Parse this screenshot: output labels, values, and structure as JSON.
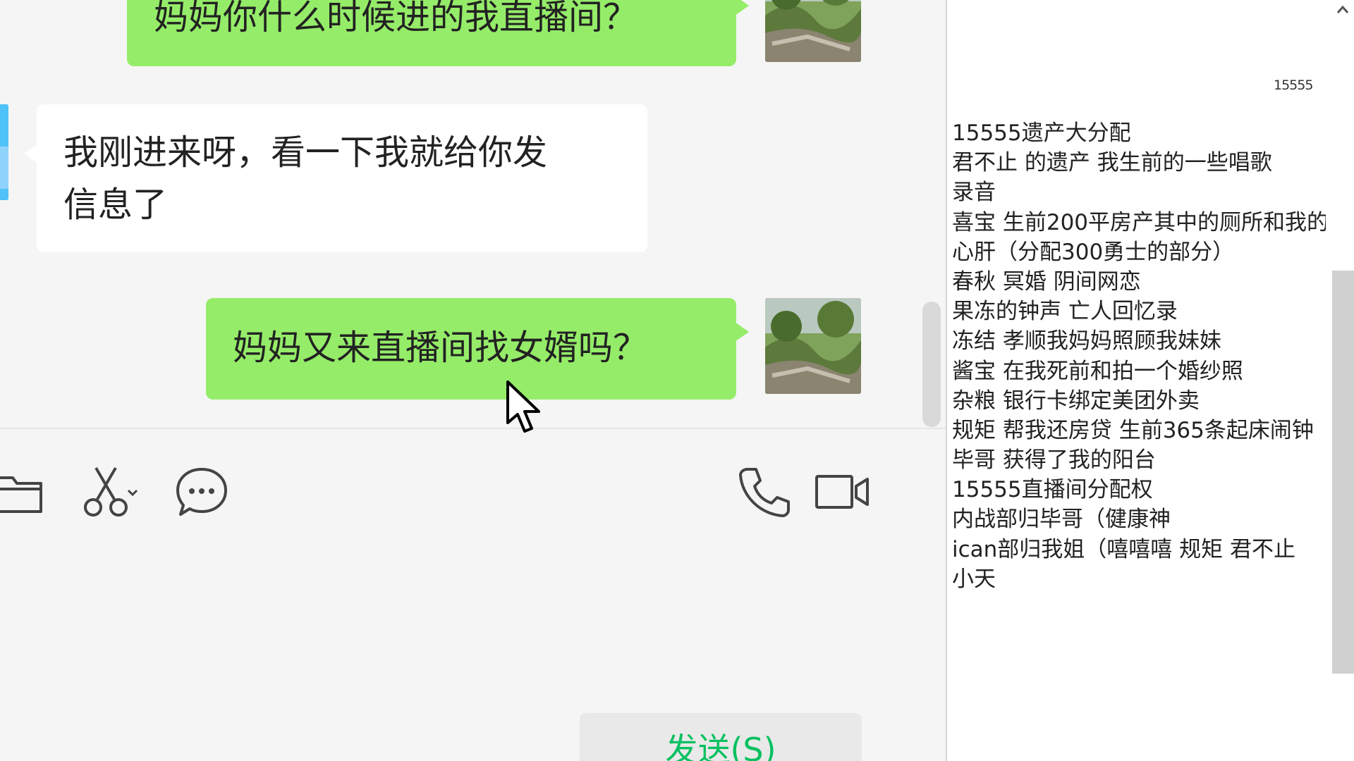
{
  "chat": {
    "messages": [
      {
        "direction": "out",
        "text": "妈妈你什么时候进的我直播间？"
      },
      {
        "direction": "in",
        "line1": "我刚进来呀，看一下我就给你发",
        "line2": "信息了"
      },
      {
        "direction": "out",
        "text": "妈妈又来直播间找女婿吗？"
      }
    ],
    "toolbar": {
      "icons": [
        "folder-icon",
        "scissors-icon",
        "chat-bubble-icon",
        "phone-icon",
        "video-icon"
      ]
    },
    "send_button_label": "发送(S)"
  },
  "side_panel": {
    "close_glyph": "✕",
    "id_label": "15555",
    "lines": [
      "15555遗产大分配",
      "君不止 的遗产 我生前的一些唱歌",
      "录音",
      "喜宝 生前200平房产其中的厕所和我的",
      "心肝（分配300勇士的部分）",
      "春秋 冥婚 阴间网恋",
      "果冻的钟声 亡人回忆录",
      "冻结   孝顺我妈妈照顾我妹妹",
      "酱宝  在我死前和拍一个婚纱照",
      "杂粮  银行卡绑定美团外卖",
      "规矩 帮我还房贷 生前365条起床闹钟",
      "毕哥 获得了我的阳台",
      "15555直播间分配权",
      "内战部归毕哥（健康神",
      "ican部归我姐（嘻嘻嘻 规矩 君不止",
      "小天"
    ]
  },
  "colors": {
    "outgoing_bubble": "#95ec69",
    "incoming_bubble": "#ffffff",
    "send_text": "#07c160",
    "chat_background": "#f5f5f5"
  }
}
